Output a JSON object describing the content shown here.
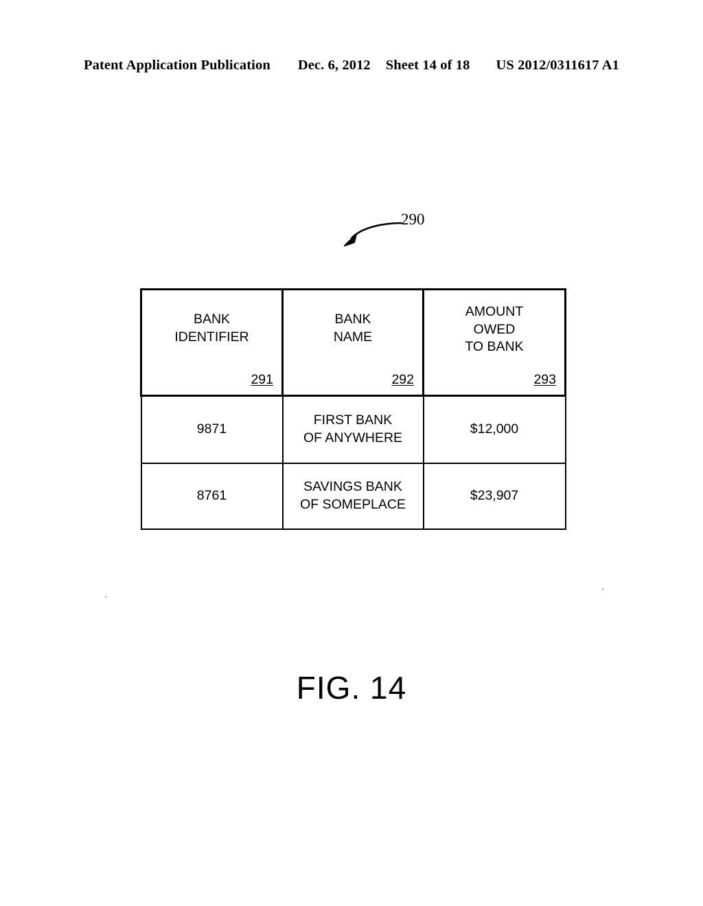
{
  "header": {
    "publication": "Patent Application Publication",
    "date": "Dec. 6, 2012",
    "sheet": "Sheet 14 of 18",
    "patent_number": "US 2012/0311617 A1"
  },
  "callout": {
    "reference": "290",
    "arrow": "curved-arrow-pointing-down-left"
  },
  "table": {
    "columns": [
      {
        "title": "BANK\nIDENTIFIER",
        "reference": "291"
      },
      {
        "title": "BANK\nNAME",
        "reference": "292"
      },
      {
        "title": "AMOUNT\nOWED\nTO BANK",
        "reference": "293"
      }
    ],
    "rows": [
      {
        "bank_identifier": "9871",
        "bank_name": "FIRST BANK\nOF ANYWHERE",
        "amount_owed": "$12,000"
      },
      {
        "bank_identifier": "8761",
        "bank_name": "SAVINGS BANK\nOF SOMEPLACE",
        "amount_owed": "$23,907"
      }
    ]
  },
  "figure": {
    "caption": "FIG. 14"
  },
  "colors": {
    "ink": "#000000",
    "paper": "#ffffff"
  }
}
